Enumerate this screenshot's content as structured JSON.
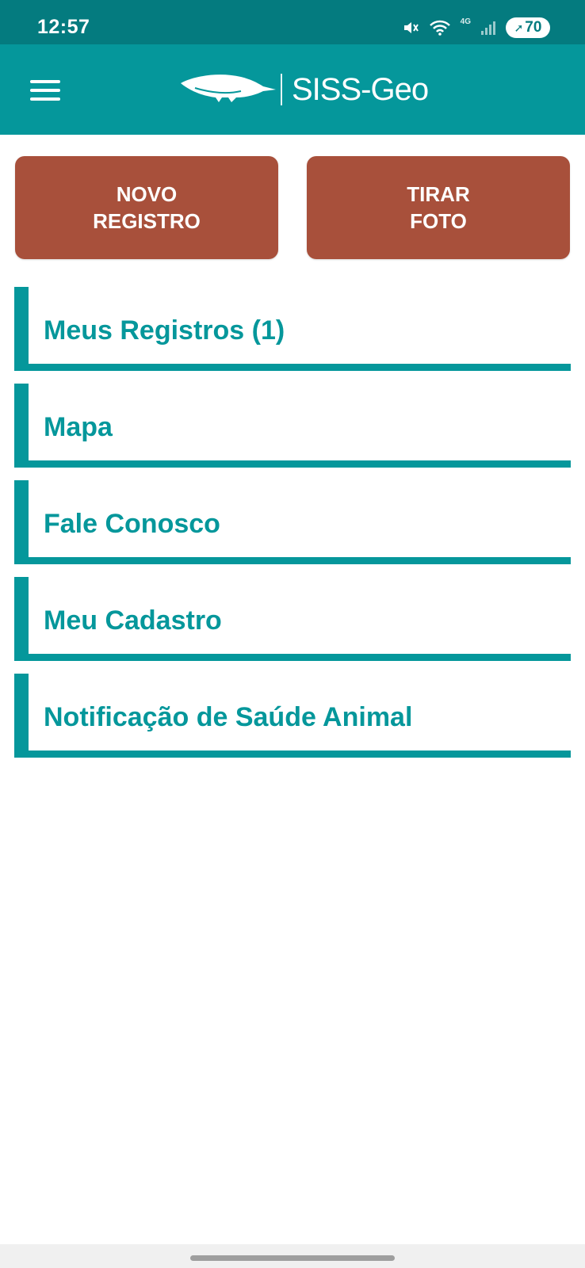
{
  "status_bar": {
    "time": "12:57",
    "network_label": "4G",
    "battery_level": "70",
    "icons": [
      "mute-icon",
      "wifi-icon",
      "signal-icon",
      "battery-icon"
    ]
  },
  "header": {
    "logo_text": "SISS-Geo",
    "menu_icon": "hamburger-menu-icon",
    "logo_icon": "anteater-icon"
  },
  "actions": {
    "new_record": [
      "NOVO",
      "REGISTRO"
    ],
    "take_photo": [
      "TIRAR",
      "FOTO"
    ]
  },
  "menu": {
    "items": [
      {
        "label": "Meus Registros (1)"
      },
      {
        "label": "Mapa"
      },
      {
        "label": "Fale Conosco"
      },
      {
        "label": "Meu Cadastro"
      },
      {
        "label": "Notificação de Saúde Animal"
      }
    ]
  },
  "colors": {
    "status_bar": "#047b7f",
    "header": "#05979b",
    "accent": "#05979b",
    "action_button": "#a8503b",
    "background": "#ffffff"
  }
}
